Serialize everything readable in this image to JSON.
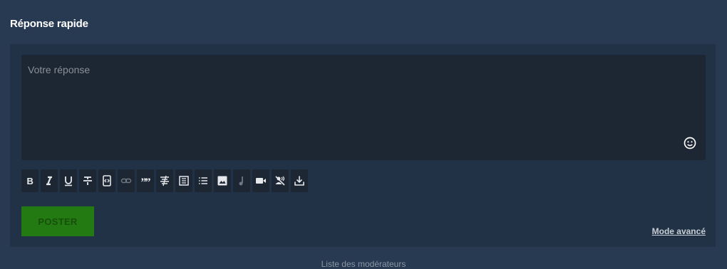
{
  "section": {
    "title": "Réponse rapide"
  },
  "editor": {
    "placeholder": "Votre réponse"
  },
  "toolbar": {
    "items": [
      {
        "name": "bold",
        "icon": "bold-icon"
      },
      {
        "name": "italic",
        "icon": "italic-icon"
      },
      {
        "name": "underline",
        "icon": "underline-icon"
      },
      {
        "name": "strikethrough",
        "icon": "strikethrough-icon"
      },
      {
        "name": "code",
        "icon": "code-icon"
      },
      {
        "name": "link",
        "icon": "link-icon"
      },
      {
        "name": "quote",
        "icon": "quote-icon"
      },
      {
        "name": "align",
        "icon": "align-icon"
      },
      {
        "name": "spoiler",
        "icon": "spoiler-icon"
      },
      {
        "name": "list",
        "icon": "list-icon"
      },
      {
        "name": "image",
        "icon": "image-icon"
      },
      {
        "name": "music",
        "icon": "music-icon"
      },
      {
        "name": "video",
        "icon": "video-icon"
      },
      {
        "name": "no-voice",
        "icon": "voice-off-icon"
      },
      {
        "name": "download",
        "icon": "download-icon"
      }
    ]
  },
  "actions": {
    "post_label": "POSTER",
    "advanced_label": "Mode avancé"
  },
  "footer": {
    "text": "Liste des modérateurs"
  },
  "colors": {
    "background": "#273a52",
    "panel": "#213247",
    "editor": "#1d2733",
    "post_button": "#237a13"
  }
}
